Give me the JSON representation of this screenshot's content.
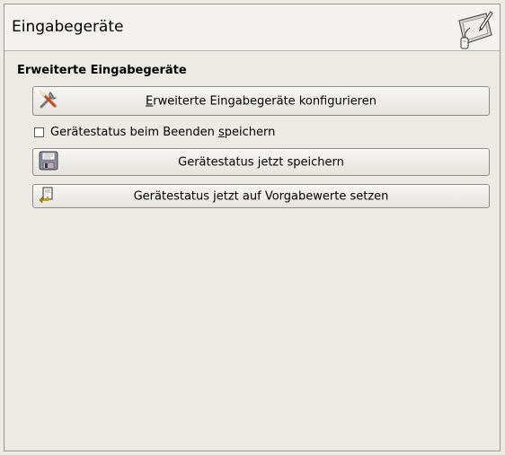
{
  "header": {
    "title": "Eingabegeräte",
    "icon": "input-devices-tablet-icon"
  },
  "section": {
    "title": "Erweiterte Eingabegeräte"
  },
  "buttons": {
    "configure": {
      "mnemonic": "E",
      "label_rest": "rweiterte Eingabegeräte konfigurieren",
      "icon": "tools-icon"
    },
    "save_now": {
      "label_before": "Gerätestatus ",
      "mnemonic": "j",
      "label_after": "etzt speichern",
      "icon": "floppy-disk-icon"
    },
    "reset_defaults": {
      "label": "Gerätestatus jetzt auf Vorgabewerte setzen",
      "icon": "revert-icon"
    }
  },
  "checkbox": {
    "label_before": "Gerätestatus beim Beenden ",
    "mnemonic": "s",
    "label_after": "peichern",
    "checked": false
  },
  "colors": {
    "background": "#edeae5",
    "header_background": "#f4f2ef",
    "border": "#9c9a94"
  }
}
